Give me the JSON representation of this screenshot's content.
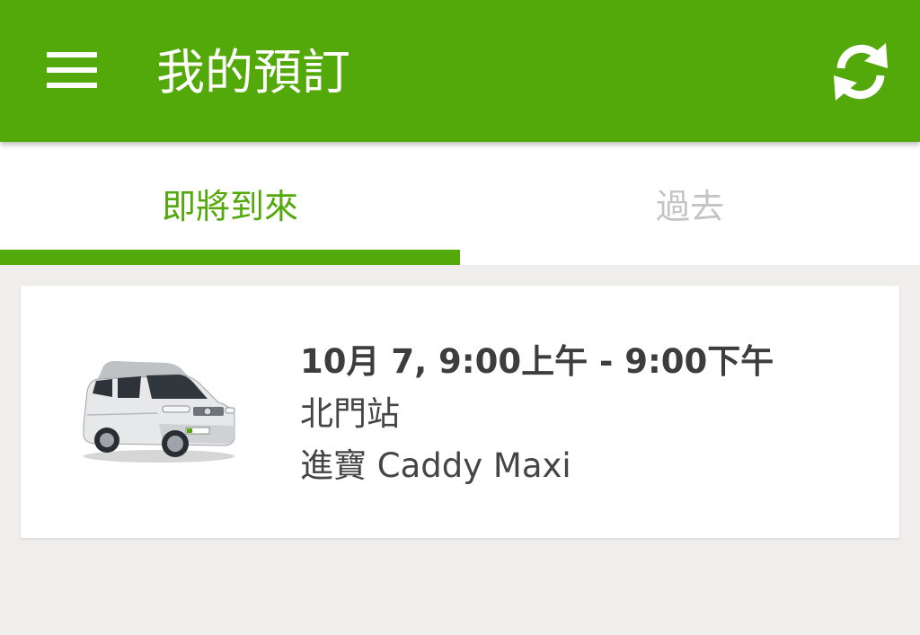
{
  "app_bar": {
    "title": "我的預訂",
    "menu_icon": "hamburger-menu-icon",
    "refresh_icon": "refresh-icon",
    "background_color": "#54a90a"
  },
  "tabs": [
    {
      "label": "即將到來",
      "active": true
    },
    {
      "label": "過去",
      "active": false
    }
  ],
  "reservations": [
    {
      "datetime": "10月 7, 9:00上午 - 9:00下午",
      "location": "北門站",
      "vehicle": "進寶 Caddy Maxi",
      "image": "white-van-image"
    }
  ],
  "colors": {
    "accent": "#54a90a",
    "background": "#efeeed",
    "inactive_tab": "#c4c4c4",
    "text_primary": "#3d3d3d"
  }
}
